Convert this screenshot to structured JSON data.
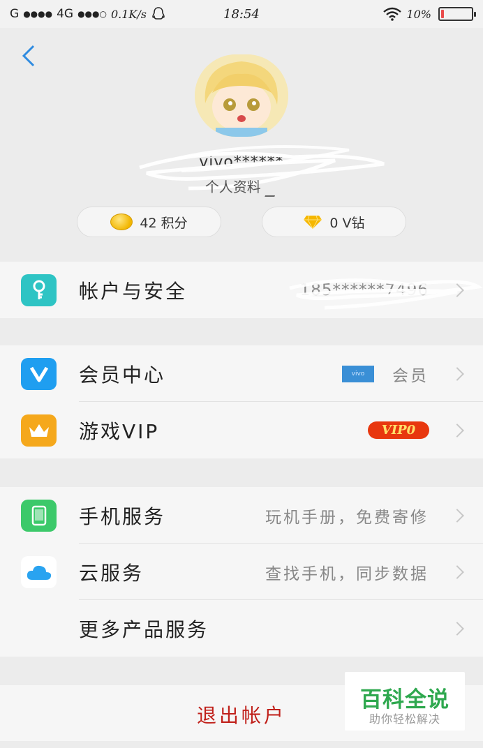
{
  "status_bar": {
    "carrier": "G",
    "signal1": "●●●●",
    "network": "4G",
    "signal2": "●●●○",
    "speed": "0.1K/s",
    "time": "18:54",
    "battery_text": "10%",
    "battery_level": 0.1,
    "battery_color": "#e94b4b"
  },
  "header": {
    "username": "vivo******",
    "profile_link": "个人资料"
  },
  "stats": {
    "points_label": "42 积分",
    "vdiamond_label": "0 V钻"
  },
  "account_group": {
    "items": [
      {
        "label": "帐户与安全",
        "value": "185******7496",
        "icon": "key-icon",
        "color": "#2ec4c4"
      }
    ]
  },
  "vip_group": {
    "items": [
      {
        "label": "会员中心",
        "value": "会员",
        "badge": "vivo",
        "icon": "vivo-v-icon",
        "color": "#1f9ef0"
      },
      {
        "label": "游戏VIP",
        "badge": "VIP0",
        "icon": "crown-icon",
        "color": "#f5a81c"
      }
    ]
  },
  "services_group": {
    "items": [
      {
        "label": "手机服务",
        "value": "玩机手册，免费寄修",
        "icon": "phone-icon",
        "color": "#3cc96a"
      },
      {
        "label": "云服务",
        "value": "查找手机，同步数据",
        "icon": "cloud-icon",
        "color": "#29a3f0"
      },
      {
        "label": "更多产品服务"
      }
    ]
  },
  "logout": {
    "label": "退出帐户"
  },
  "watermark": {
    "title": "百科全说",
    "subtitle": "助你轻松解决"
  },
  "colors": {
    "accent": "#2f8be0",
    "logout": "#c0201a",
    "watermark": "#2fa84f"
  }
}
